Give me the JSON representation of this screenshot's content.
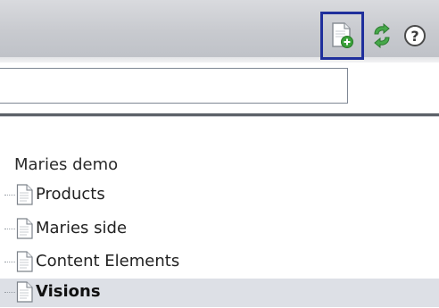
{
  "toolbar": {
    "new_page_icon": "page-add-icon",
    "refresh_icon": "refresh-icon",
    "help_icon": "help-icon",
    "help_glyph": "?",
    "highlight_color": "#1f2f9c"
  },
  "search": {
    "value": "",
    "placeholder": ""
  },
  "tree": {
    "root_label": "Maries demo",
    "items": [
      {
        "label": "Products",
        "icon": "page-icon",
        "selected": false
      },
      {
        "label": "Maries side",
        "icon": "page-icon",
        "selected": false
      },
      {
        "label": "Content Elements",
        "icon": "page-icon",
        "selected": false
      },
      {
        "label": "Visions",
        "icon": "page-icon",
        "selected": true
      }
    ]
  },
  "colors": {
    "toolbar_bg": "#c8cacf",
    "divider": "#5c6168",
    "selected_row": "#dde0e6"
  }
}
